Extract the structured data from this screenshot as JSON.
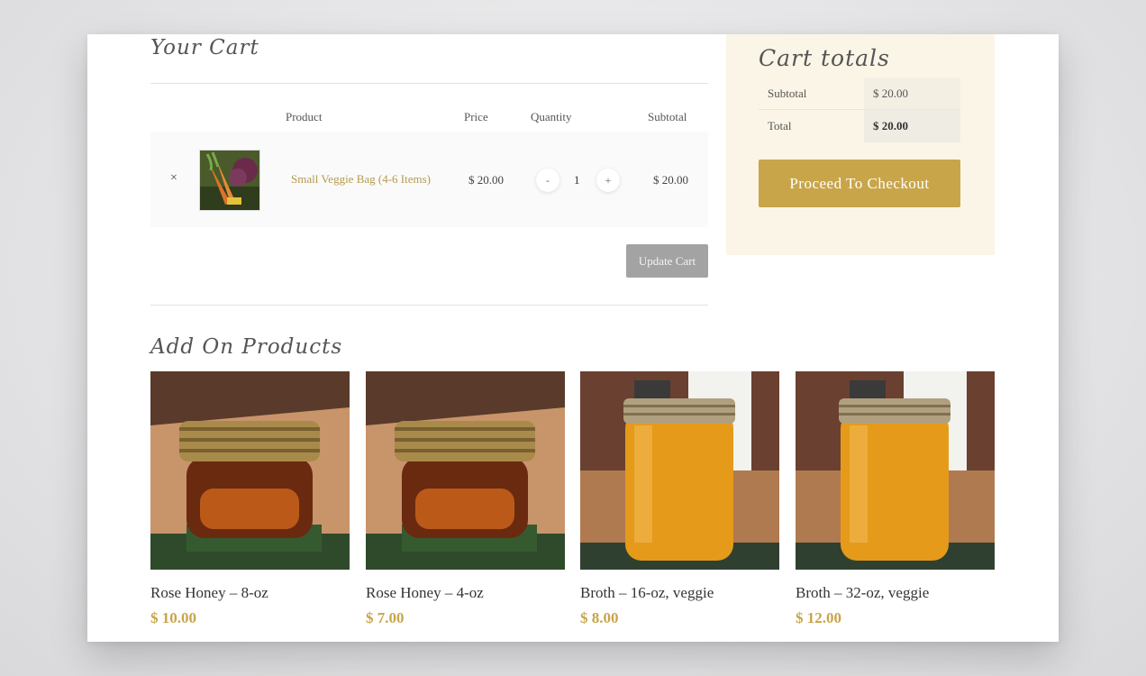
{
  "cart": {
    "title": "Your Cart",
    "headers": {
      "product": "Product",
      "price": "Price",
      "quantity": "Quantity",
      "subtotal": "Subtotal"
    },
    "item": {
      "remove": "×",
      "name": "Small Veggie Bag (4-6 Items)",
      "price": "$ 20.00",
      "qty_minus": "-",
      "qty": "1",
      "qty_plus": "+",
      "subtotal": "$ 20.00"
    },
    "update_label": "Update Cart"
  },
  "totals": {
    "title": "Cart totals",
    "subtotal_label": "Subtotal",
    "subtotal_value": "$ 20.00",
    "total_label": "Total",
    "total_value": "$ 20.00",
    "checkout_label": "Proceed To Checkout"
  },
  "addons": {
    "title": "Add On Products",
    "products": [
      {
        "name": "Rose Honey – 8-oz",
        "price": "$ 10.00"
      },
      {
        "name": "Rose Honey – 4-oz",
        "price": "$ 7.00"
      },
      {
        "name": "Broth – 16-oz, veggie",
        "price": "$ 8.00"
      },
      {
        "name": "Broth – 32-oz, veggie",
        "price": "$ 12.00"
      }
    ]
  },
  "colors": {
    "accent": "#c9a54a",
    "link": "#b59a4f",
    "totals_bg": "#faf5e6",
    "update_btn": "#a3a3a3"
  }
}
